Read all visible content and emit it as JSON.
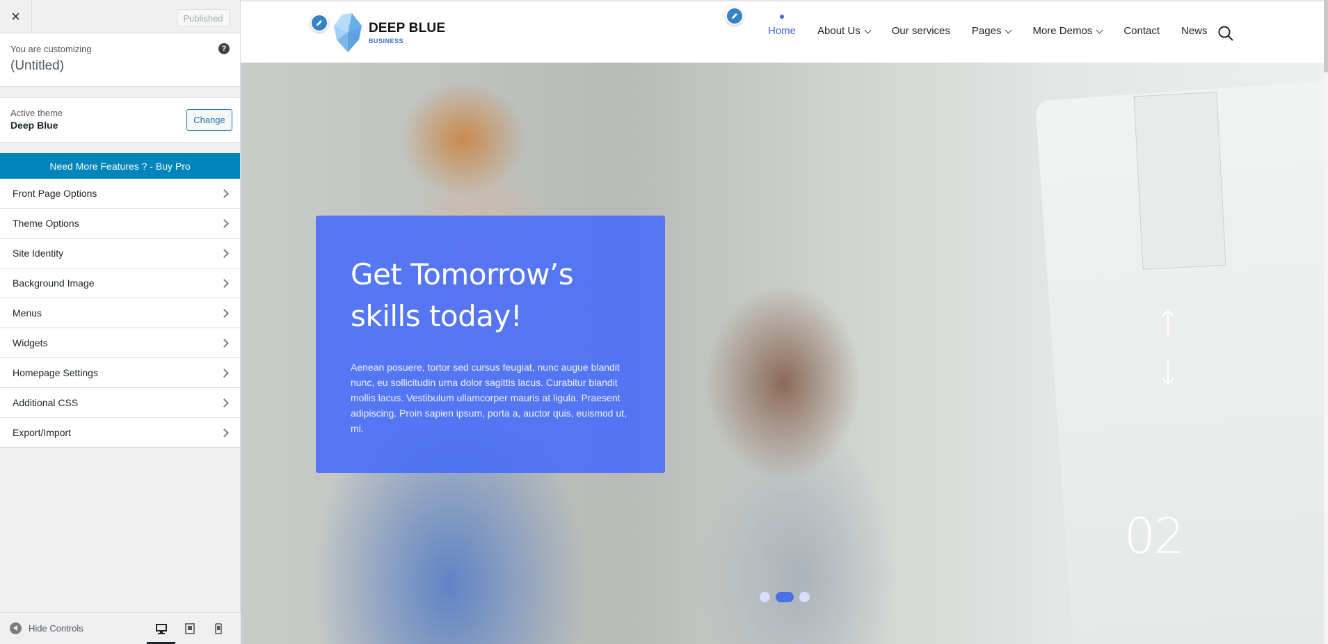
{
  "sidebar": {
    "close_label": "×",
    "publish_label": "Published",
    "customizing_label": "You are customizing",
    "site_title": "(Untitled)",
    "help_label": "?",
    "active_theme_label": "Active theme",
    "theme_name": "Deep Blue",
    "change_label": "Change",
    "buy_pro_label": "Need More Features ? - Buy Pro",
    "sections": [
      {
        "label": "Front Page Options"
      },
      {
        "label": "Theme Options"
      },
      {
        "label": "Site Identity"
      },
      {
        "label": "Background Image"
      },
      {
        "label": "Menus"
      },
      {
        "label": "Widgets"
      },
      {
        "label": "Homepage Settings"
      },
      {
        "label": "Additional CSS"
      },
      {
        "label": "Export/Import"
      }
    ],
    "hide_controls_label": "Hide Controls",
    "devices": [
      "desktop-icon",
      "tablet-icon",
      "mobile-icon"
    ],
    "active_device": "desktop"
  },
  "site": {
    "logo_title": "DEEP BLUE",
    "logo_subtitle": "BUSINESS",
    "nav": [
      {
        "label": "Home",
        "active": true,
        "dropdown": false
      },
      {
        "label": "About Us",
        "active": false,
        "dropdown": true
      },
      {
        "label": "Our services",
        "active": false,
        "dropdown": false
      },
      {
        "label": "Pages",
        "active": false,
        "dropdown": true
      },
      {
        "label": "More Demos",
        "active": false,
        "dropdown": true
      },
      {
        "label": "Contact",
        "active": false,
        "dropdown": false
      },
      {
        "label": "News",
        "active": false,
        "dropdown": false
      }
    ]
  },
  "hero": {
    "title_line1": "Get Tomorrow’s",
    "title_line2": "skills today!",
    "text": "Aenean posuere, tortor sed cursus feugiat, nunc augue blandit nunc, eu sollicitudin urna dolor sagittis lacus. Curabitur blandit mollis lacus. Vestibulum ullamcorper mauris at ligula. Praesent adipiscing. Proin sapien ipsum, porta a, auctor quis, euismod ut, mi.",
    "slide_number": "02",
    "slide_count": 3,
    "active_slide": 2
  },
  "colors": {
    "accent": "#3d63dd",
    "customizer_blue": "#0085ba",
    "wp_link": "#2271b1",
    "hero_box": "#496efa"
  }
}
